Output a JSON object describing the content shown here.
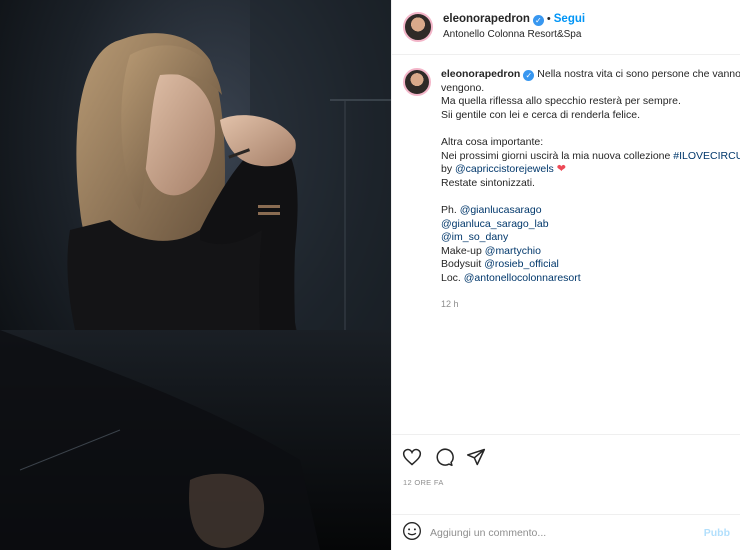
{
  "header": {
    "username": "eleonorapedron",
    "follow_label": "Segui",
    "separator": "•",
    "location": "Antonello Colonna Resort&Spa"
  },
  "caption": {
    "username": "eleonorapedron",
    "lines": [
      "Nella nostra vita ci sono persone che vanno e",
      "vengono.",
      "Ma quella riflessa allo specchio resterà per sempre.",
      "Sii gentile con lei e cerca di renderla felice."
    ],
    "line_important": "Altra cosa importante:",
    "line_collection_prefix": "Nei prossimi giorni uscirà la mia nuova collezione ",
    "hashtag": "#ILOVECIRCUM",
    "by_prefix": "by ",
    "by_tag": "@capriccistorejewels",
    "heart": "❤",
    "stay_tuned": "Restate sintonizzati.",
    "credits": [
      {
        "prefix": "Ph. ",
        "tag": "@gianlucasarago"
      },
      {
        "prefix": "",
        "tag": "@gianluca_sarago_lab"
      },
      {
        "prefix": "",
        "tag": "@im_so_dany"
      },
      {
        "prefix": "Make-up ",
        "tag": "@martychio"
      },
      {
        "prefix": "Bodysuit ",
        "tag": "@rosieb_official"
      },
      {
        "prefix": "Loc. ",
        "tag": "@antonellocolonnaresort"
      }
    ],
    "age": "12 h"
  },
  "post_date": "12 ORE FA",
  "comment_box": {
    "placeholder": "Aggiungi un commento...",
    "publish_label": "Pubb"
  },
  "icons": {
    "verified": "verified-badge-icon",
    "like": "heart-icon",
    "comment": "comment-bubble-icon",
    "share": "paper-plane-icon",
    "emoji": "emoji-smile-icon"
  },
  "colors": {
    "link": "#00376b",
    "follow": "#0095f6",
    "verified": "#3897f0",
    "muted": "#8e8e8e",
    "publish_disabled": "#b2dffc"
  }
}
